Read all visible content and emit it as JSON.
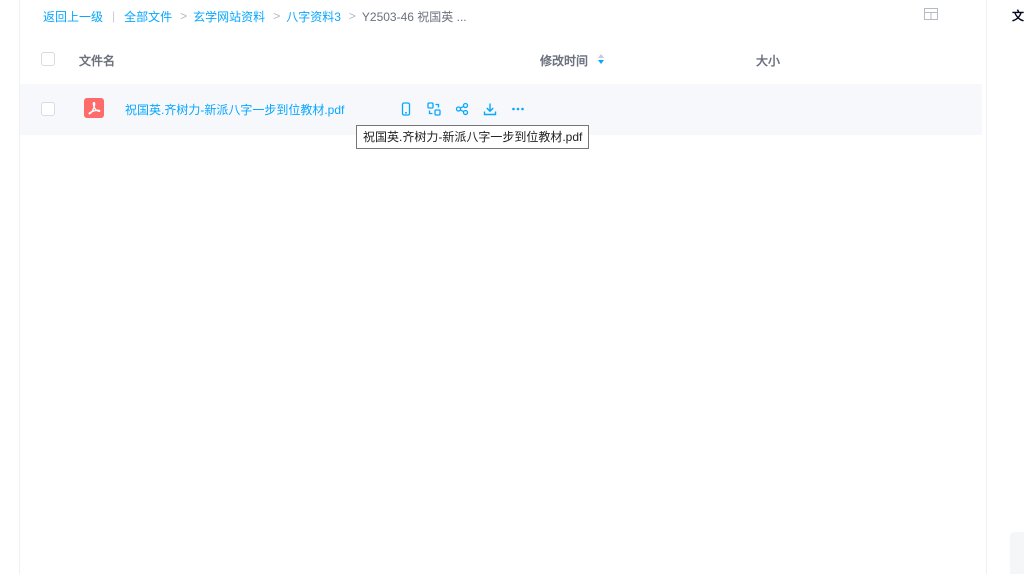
{
  "breadcrumb": {
    "back": "返回上一级",
    "sep": ">",
    "items": [
      "全部文件",
      "玄学网站资料",
      "八字资料3"
    ],
    "current": "Y2503-46 祝国英 ..."
  },
  "columns": {
    "name": "文件名",
    "modified": "修改时间",
    "size": "大小"
  },
  "files": [
    {
      "name": "祝国英.齐树力-新派八字一步到位教材.pdf",
      "type": "pdf"
    }
  ],
  "tooltip": {
    "text": "祝国英.齐树力-新派八字一步到位教材.pdf"
  },
  "right_panel": {
    "title": "文件"
  },
  "colors": {
    "accent": "#06a7ff",
    "pdf": "#ff6a6a",
    "row_hover": "#f6f8fc"
  }
}
